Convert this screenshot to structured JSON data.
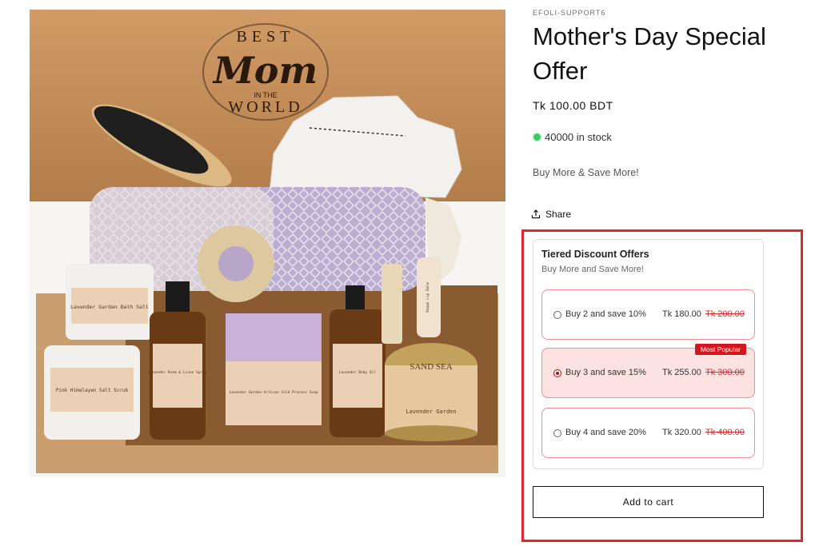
{
  "product": {
    "vendor": "EFOLI-SUPPORT6",
    "title": "Mother's Day Special Offer",
    "price": "Tk 100.00 BDT",
    "stock": "40000 in stock",
    "promo": "Buy More & Save More!",
    "share_label": "Share",
    "image": {
      "box_lid_text": [
        "BEST",
        "Mom",
        "IN THE",
        "WORLD"
      ],
      "item_labels": [
        "Lavender Garden Bath Salt",
        "Pink Himalayan Salt Scrub",
        "Lavender Room & Linen Spray",
        "Lavender Garden Artisan Cold Process Soap",
        "Lavender Body Oil",
        "Lavender Garden",
        "Vegan Lip Balm"
      ],
      "brand_mark": "SAND SEA"
    }
  },
  "tiers": {
    "title": "Tiered Discount Offers",
    "subtitle": "Buy More and Save More!",
    "items": [
      {
        "label": "Buy 2 and save 10%",
        "price": "Tk 180.00",
        "compare": "Tk 200.00",
        "selected": false
      },
      {
        "label": "Buy 3 and save 15%",
        "price": "Tk 255.00",
        "compare": "Tk 300.00",
        "selected": true,
        "badge": "Most Popular"
      },
      {
        "label": "Buy 4 and save 20%",
        "price": "Tk 320.00",
        "compare": "Tk 400.00",
        "selected": false
      }
    ]
  },
  "add_to_cart_label": "Add to cart",
  "colors": {
    "highlight": "#e0262b",
    "accent_red": "#d8141b",
    "stock_green": "#3cc962",
    "selected_bg": "#fde2e2"
  }
}
